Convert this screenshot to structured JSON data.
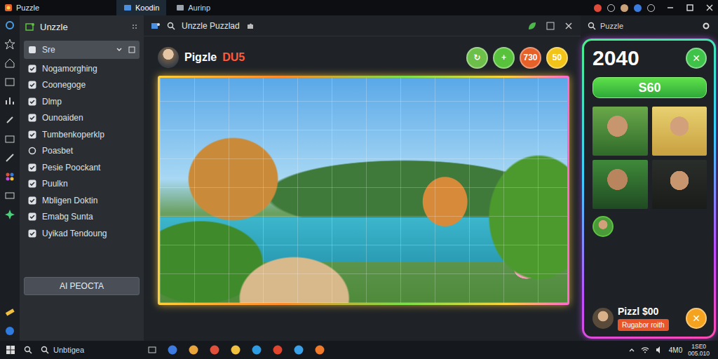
{
  "window": {
    "title": "Puzzle",
    "tabs": [
      {
        "label": "Koodin",
        "selected": true
      },
      {
        "label": "Aurinp",
        "selected": false
      }
    ]
  },
  "sidebar": {
    "title": "Unzzle",
    "items": [
      {
        "label": "Sre",
        "kind": "dropdown",
        "selected": true
      },
      {
        "label": "Nogamorghing",
        "kind": "checkbox",
        "checked": true,
        "selected": false
      },
      {
        "label": "Coonegoge",
        "kind": "checkbox",
        "checked": true,
        "selected": false
      },
      {
        "label": "Dlmp",
        "kind": "checkbox",
        "checked": true,
        "selected": false
      },
      {
        "label": "Ounoaiden",
        "kind": "checkbox",
        "checked": true,
        "selected": false
      },
      {
        "label": "Tumbenkoperklp",
        "kind": "checkbox",
        "checked": true,
        "selected": false
      },
      {
        "label": "Poasbet",
        "kind": "radio",
        "checked": false,
        "selected": false
      },
      {
        "label": "Pesie Poockant",
        "kind": "checkbox",
        "checked": true,
        "selected": false
      },
      {
        "label": "Puulkn",
        "kind": "checkbox",
        "checked": true,
        "selected": false
      },
      {
        "label": "Mbligen Doktin",
        "kind": "checkbox",
        "checked": true,
        "selected": false
      },
      {
        "label": "Emabg Sunta",
        "kind": "checkbox",
        "checked": true,
        "selected": false
      },
      {
        "label": "Uyikad Tendoung",
        "kind": "checkbox",
        "checked": true,
        "selected": false
      }
    ],
    "button": "AI PEOCTA"
  },
  "toolbar": {
    "title": "Unzzle Puzzlad"
  },
  "game": {
    "title": "Pigzle",
    "tag": "DU5",
    "actions": [
      {
        "label": "↻",
        "color": "#6cc04a"
      },
      {
        "label": "+",
        "color": "#58c23c"
      },
      {
        "label": "730",
        "color": "#e6602a"
      },
      {
        "label": "50",
        "color": "#f2c41a"
      }
    ]
  },
  "search": {
    "placeholder": "Puzzle"
  },
  "scoreboard": {
    "score": "2040",
    "close": "✕",
    "action": "S60",
    "footer": {
      "name": "Pizzl $00",
      "button": "Rugabor roith",
      "close": "✕"
    }
  },
  "taskbar": {
    "search": "Unbtigea",
    "time": "4M0",
    "date": [
      "1SE0",
      "005.010"
    ]
  }
}
